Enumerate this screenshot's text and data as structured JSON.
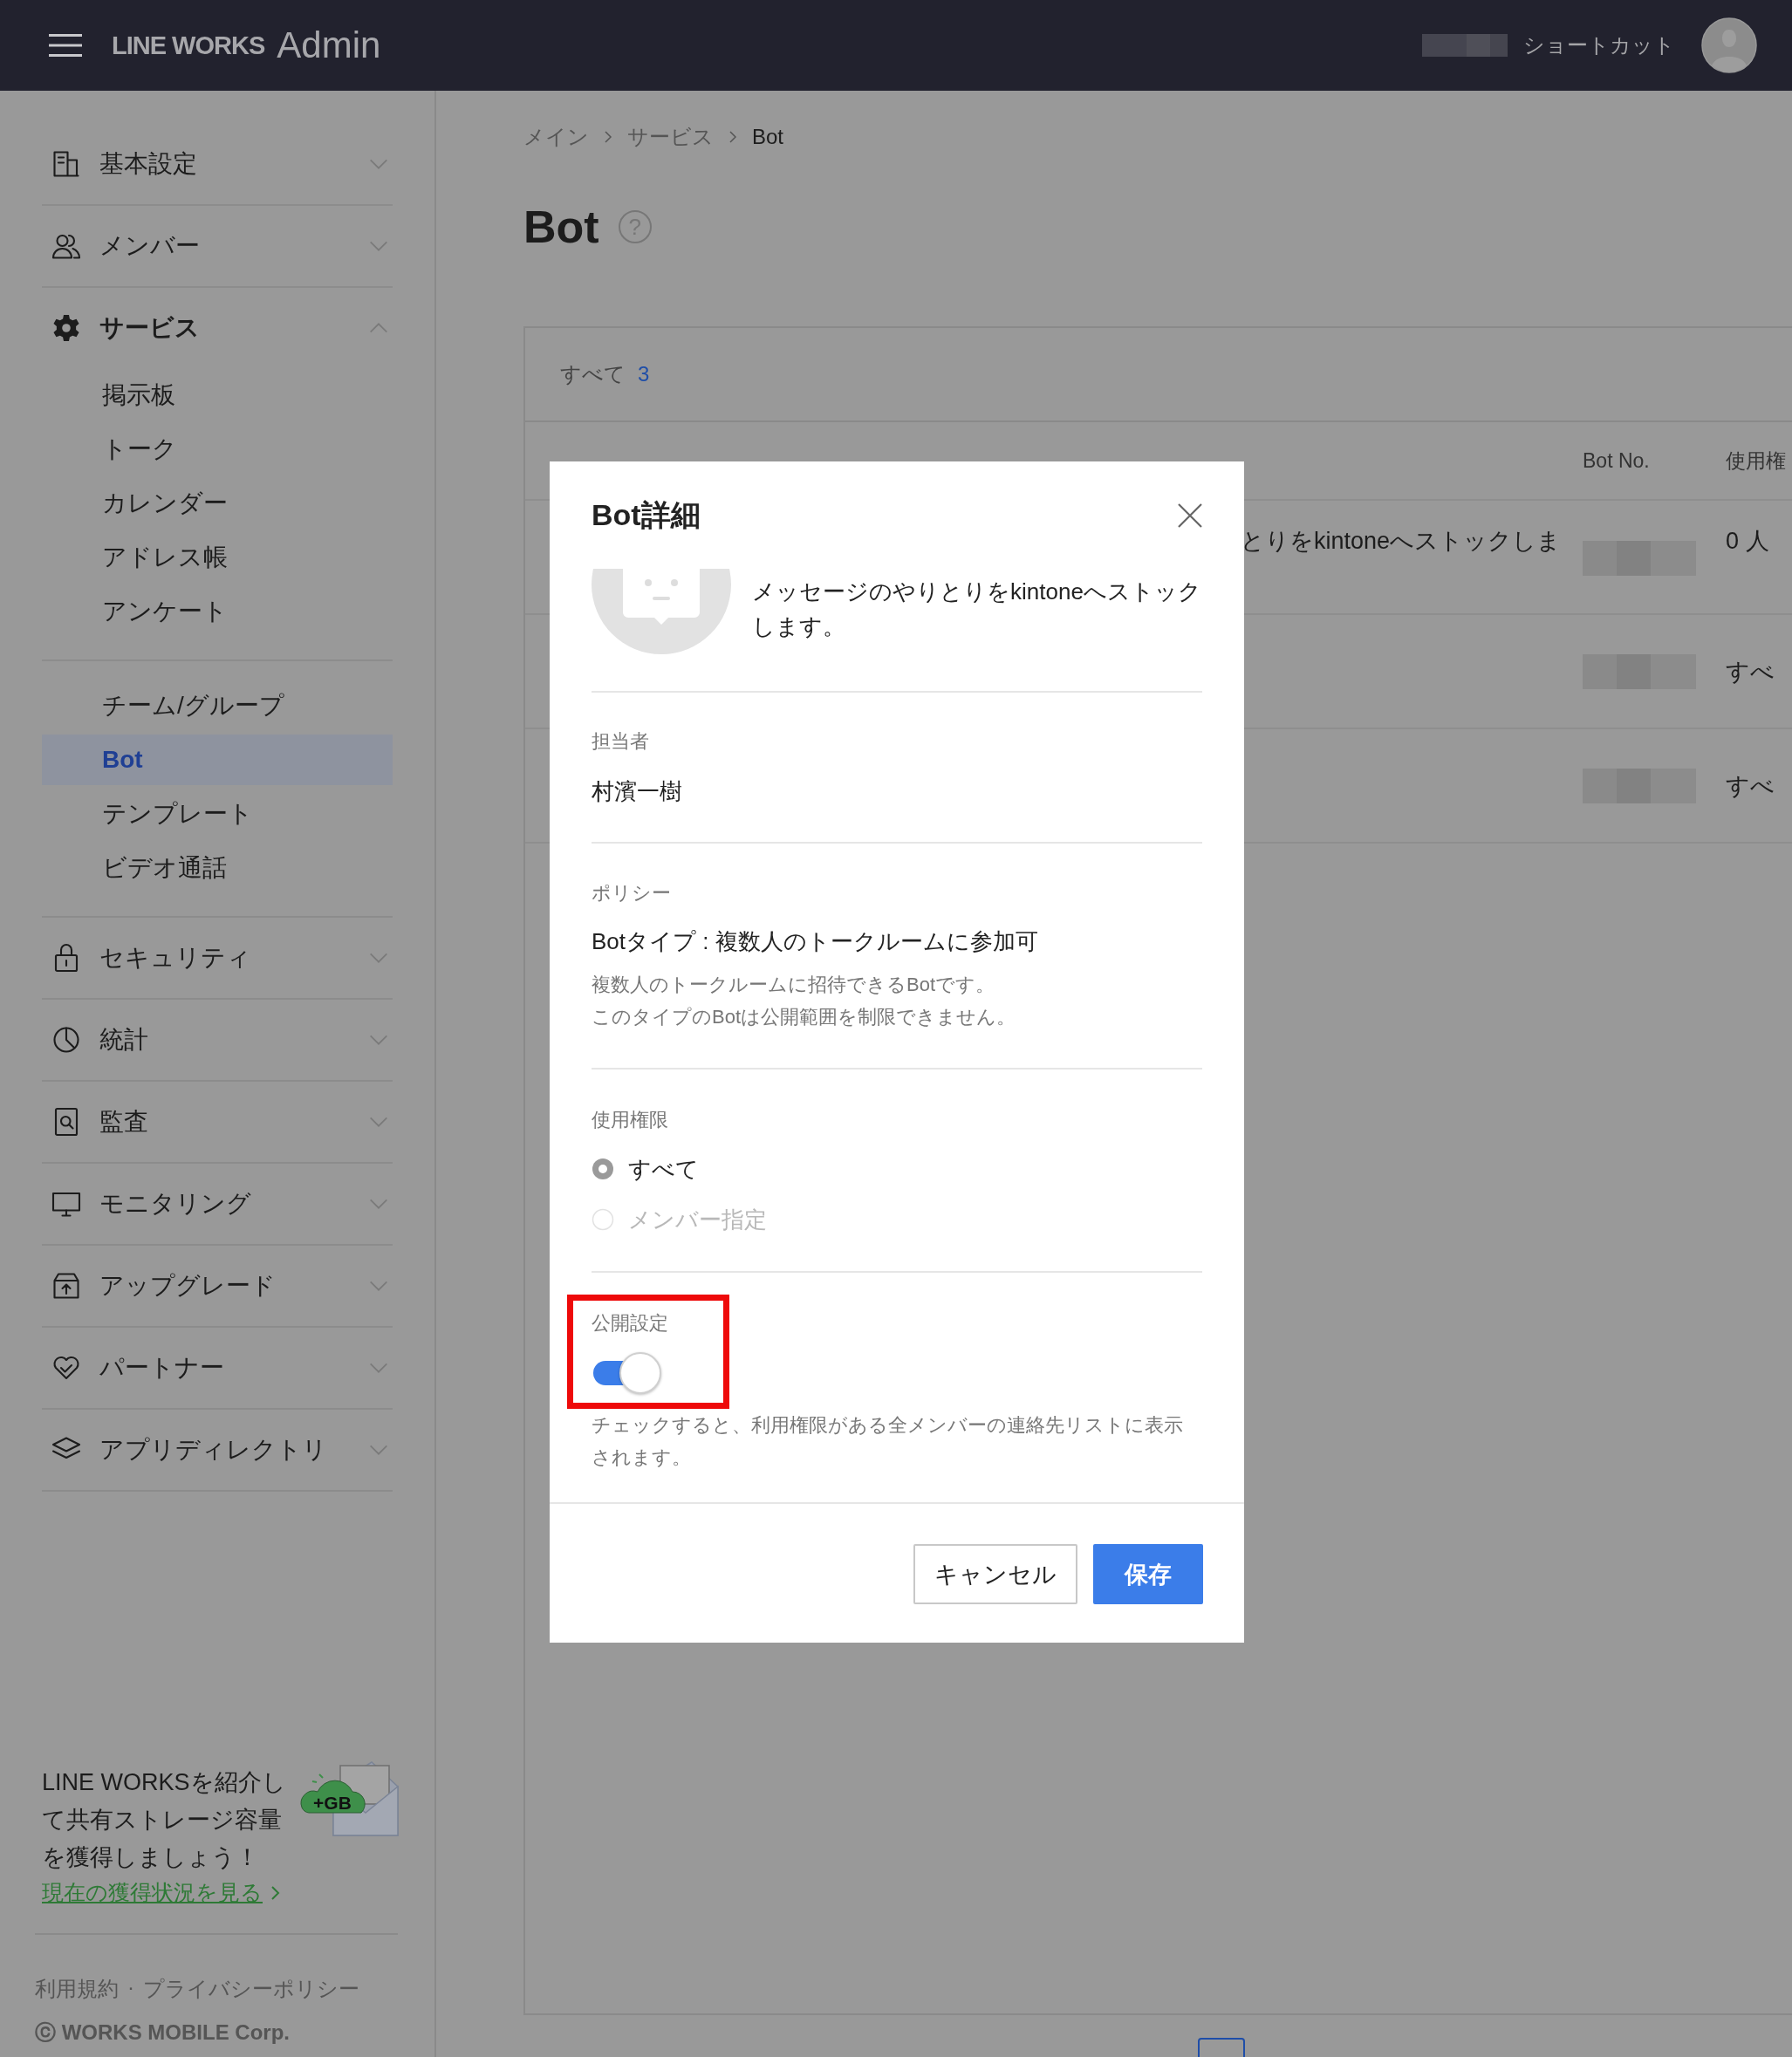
{
  "header": {
    "brand": "LINE WORKS",
    "product": "Admin",
    "shortcut": "ショートカット"
  },
  "sidebar": {
    "sections": [
      {
        "label": "基本設定",
        "expanded": false
      },
      {
        "label": "メンバー",
        "expanded": false
      },
      {
        "label": "サービス",
        "expanded": true,
        "groups": [
          {
            "items": [
              {
                "label": "掲示板",
                "selected": false
              },
              {
                "label": "トーク",
                "selected": false
              },
              {
                "label": "カレンダー",
                "selected": false
              },
              {
                "label": "アドレス帳",
                "selected": false
              },
              {
                "label": "アンケート",
                "selected": false
              }
            ]
          },
          {
            "items": [
              {
                "label": "チーム/グループ",
                "selected": false
              },
              {
                "label": "Bot",
                "selected": true
              },
              {
                "label": "テンプレート",
                "selected": false
              },
              {
                "label": "ビデオ通話",
                "selected": false
              }
            ]
          }
        ]
      },
      {
        "label": "セキュリティ",
        "expanded": false
      },
      {
        "label": "統計",
        "expanded": false
      },
      {
        "label": "監査",
        "expanded": false
      },
      {
        "label": "モニタリング",
        "expanded": false
      },
      {
        "label": "アップグレード",
        "expanded": false
      },
      {
        "label": "パートナー",
        "expanded": false
      },
      {
        "label": "アプリディレクトリ",
        "expanded": false
      }
    ],
    "promo": {
      "text": "LINE WORKSを紹介して共有ストレージ容量を獲得しましょう！",
      "link": "現在の獲得状況を見る",
      "badge": "+GB"
    },
    "footer": {
      "links": [
        "利用規約",
        "プライバシーポリシー"
      ],
      "separator": "·",
      "copyright": "ⓒ WORKS MOBILE Corp."
    }
  },
  "breadcrumb": [
    "メイン",
    "サービス",
    "Bot"
  ],
  "title": "Bot",
  "title_help": "?",
  "card": {
    "filter": {
      "label": "すべて",
      "count": "3"
    },
    "columns": [
      "Bot No.",
      "使用権"
    ],
    "rows": [
      {
        "description": "とりをkintoneへストックしま",
        "usage": "0 人"
      },
      {
        "description": "",
        "usage": "すべ"
      },
      {
        "description": "",
        "usage": "すべ"
      }
    ]
  },
  "modal": {
    "title": "Bot詳細",
    "description": "メッセージのやりとりをkintoneへストックします。",
    "owner": {
      "label": "担当者",
      "value": "村濱一樹"
    },
    "policy": {
      "label": "ポリシー",
      "value": "Botタイプ : 複数人のトークルームに参加可",
      "notes": [
        "複数人のトークルームに招待できるBotです。",
        "このタイプのBotは公開範囲を制限できません。"
      ]
    },
    "permission": {
      "label": "使用権限",
      "options": [
        {
          "label": "すべて",
          "selected": true,
          "disabled": false
        },
        {
          "label": "メンバー指定",
          "selected": false,
          "disabled": true
        }
      ]
    },
    "visibility": {
      "label": "公開設定",
      "on": true,
      "highlighted": true,
      "help": "チェックすると、利用権限がある全メンバーの連絡先リストに表示されます。"
    },
    "buttons": [
      {
        "label": "キャンセル",
        "kind": "secondary"
      },
      {
        "label": "保存",
        "kind": "primary"
      }
    ]
  }
}
